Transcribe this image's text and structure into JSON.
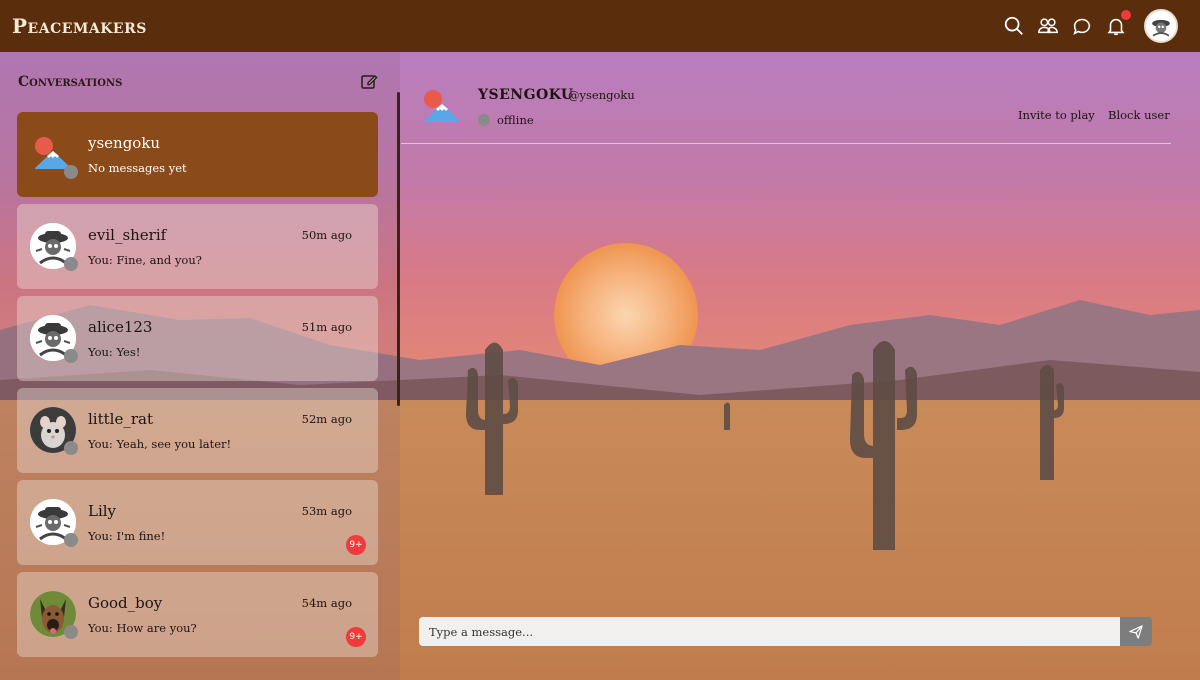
{
  "app": {
    "brand": "Peacemakers"
  },
  "nav": {
    "icons": [
      "search-icon",
      "friends-icon",
      "chat-icon",
      "bell-icon"
    ],
    "has_notification": true
  },
  "sidebar": {
    "title": "Conversations",
    "conversations": [
      {
        "name": "ysengoku",
        "preview": "No messages yet",
        "time": "",
        "unread": "",
        "avatar": "mount-fuji",
        "active": true
      },
      {
        "name": "evil_sherif",
        "preview": "You: Fine, and you?",
        "time": "50m ago",
        "unread": "",
        "avatar": "skull-cowboy"
      },
      {
        "name": "alice123",
        "preview": "You: Yes!",
        "time": "51m ago",
        "unread": "",
        "avatar": "skull-cowboy"
      },
      {
        "name": "little_rat",
        "preview": "You: Yeah, see you later!",
        "time": "52m ago",
        "unread": "",
        "avatar": "rat-photo"
      },
      {
        "name": "Lily",
        "preview": "You: I'm fine!",
        "time": "53m ago",
        "unread": "9+",
        "avatar": "skull-cowboy"
      },
      {
        "name": "Good_boy",
        "preview": "You: How are you?",
        "time": "54m ago",
        "unread": "9+",
        "avatar": "dog-photo"
      }
    ]
  },
  "chat": {
    "name": "YSENGOKU",
    "handle": "@ysengoku",
    "status": "offline",
    "invite_label": "Invite to play",
    "block_label": "Block user",
    "input_placeholder": "Type a message..."
  },
  "colors": {
    "topbar": "#5a2d0c",
    "active_conversation": "#8b4a1a",
    "unread_badge": "#ef3b3b",
    "offline_dot": "#8a8a8a"
  }
}
